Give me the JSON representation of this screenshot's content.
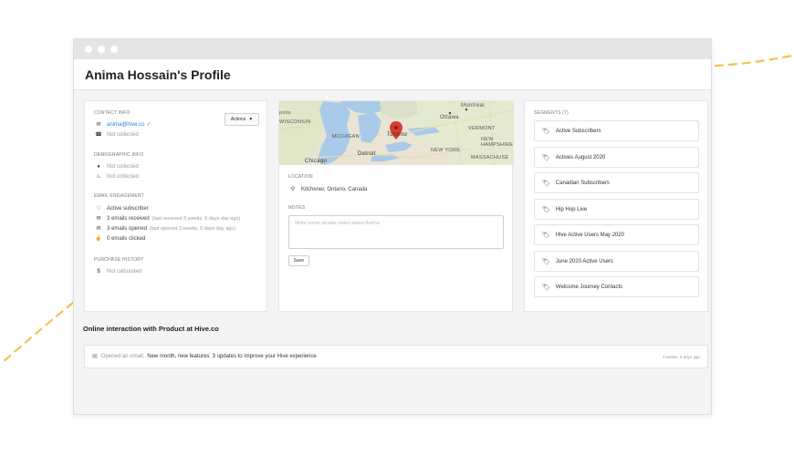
{
  "window": {
    "title": "Anima Hossain's Profile"
  },
  "contact": {
    "section_label": "CONTACT INFO",
    "actions_label": "Actions",
    "email": "anima@hive.co",
    "phone": "Not collected"
  },
  "demographic": {
    "section_label": "DEMOGRAPHIC INFO",
    "gender": "Not collected",
    "birthday": "Not collected"
  },
  "engagement": {
    "section_label": "EMAIL ENGAGEMENT",
    "status": "Active subscriber",
    "received": "3 emails received",
    "received_note": "(last received 3 weeks, 5 days day ago)",
    "opened": "3 emails opened",
    "opened_note": "(last opened 3 weeks, 5 days day ago)",
    "clicked": "0 emails clicked"
  },
  "purchase": {
    "section_label": "PURCHASE HISTORY",
    "value": "Not calculated"
  },
  "map": {
    "labels": [
      "Montreal",
      "Ottawa",
      "VERMONT",
      "NEW HAMPSHIRE",
      "MASSACHUSE",
      "NEW YORK",
      "MICHIGAN",
      "WISCONSIN",
      "Detroit",
      "Toronto",
      "Chicago",
      "polis"
    ]
  },
  "location": {
    "section_label": "LOCATION",
    "value": "Kitchener, Ontario, Canada"
  },
  "notes": {
    "section_label": "NOTES",
    "placeholder": "Write some private notes about Anima",
    "save_label": "Save"
  },
  "segments": {
    "section_label": "SEGMENTS (7)",
    "items": [
      "Active Subscribers",
      "Actives August 2020",
      "Canadian Subscribers",
      "Hip Hop Live",
      "Hive Active Users May 2020",
      "June 2020 Active Users",
      "Welcome Journey Contacts"
    ]
  },
  "online": {
    "title": "Online interaction with Product at Hive.co",
    "event_prefix": "Opened an email:",
    "event_subject": "New month, new features: 3 updates to improve your Hive experience",
    "event_time": "3 weeks, 5 days ago"
  },
  "colors": {
    "accent_link": "#2a7ae2",
    "check_green": "#3bb44a",
    "deco_dash": "#f2c14e",
    "map_pin": "#d93a2f"
  }
}
